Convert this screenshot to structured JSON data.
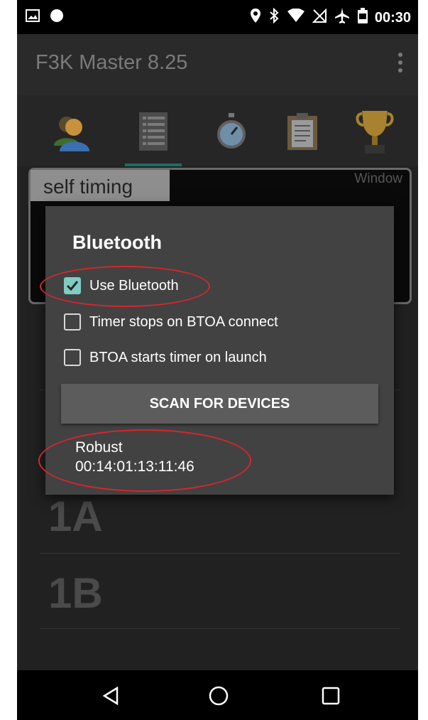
{
  "statusbar": {
    "time": "00:30",
    "left_icons": [
      "image-icon",
      "circle-dot-icon"
    ],
    "right_icons": [
      "location-icon",
      "bluetooth-icon",
      "wifi-icon",
      "no-sim-icon",
      "airplane-icon",
      "battery-icon"
    ]
  },
  "appbar": {
    "title": "F3K Master 8.25",
    "menu_icon": "overflow-menu-icon"
  },
  "tabs": [
    {
      "icon": "pilots-icon"
    },
    {
      "icon": "list-icon",
      "selected": true
    },
    {
      "icon": "stopwatch-icon"
    },
    {
      "icon": "clipboard-icon"
    },
    {
      "icon": "trophy-icon"
    }
  ],
  "panel": {
    "label": "self timing",
    "window_label": "Window"
  },
  "heats": [
    "1A",
    "1B"
  ],
  "dialog": {
    "title": "Bluetooth",
    "options": [
      {
        "label": "Use Bluetooth",
        "checked": true
      },
      {
        "label": "Timer stops on BTOA connect",
        "checked": false
      },
      {
        "label": "BTOA starts timer on launch",
        "checked": false
      }
    ],
    "scan_button": "SCAN FOR DEVICES",
    "device": {
      "name": "Robust",
      "address": "00:14:01:13:11:46"
    }
  },
  "colors": {
    "accent": "#80cbc4",
    "annotation": "#d7262e",
    "dialog_bg": "#424242"
  }
}
